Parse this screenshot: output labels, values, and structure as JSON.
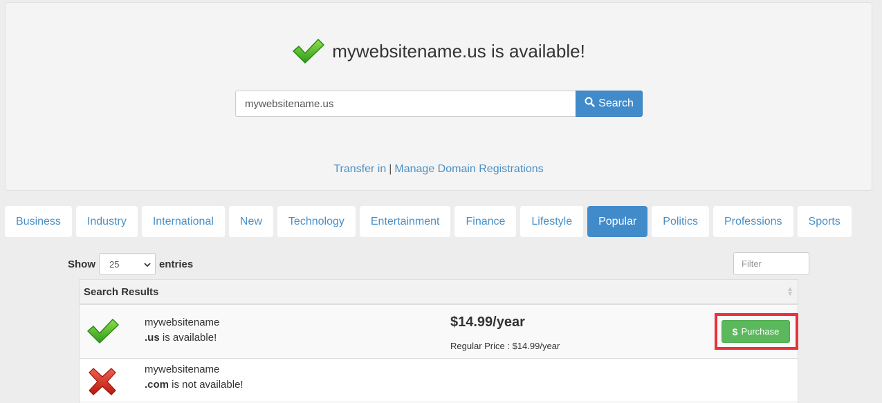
{
  "header": {
    "headline": "mywebsitename.us is available!"
  },
  "search": {
    "value": "mywebsitename.us",
    "button_label": "Search"
  },
  "links": {
    "transfer": "Transfer in",
    "separator": "|",
    "manage": "Manage Domain Registrations"
  },
  "tabs": [
    {
      "label": "Business",
      "active": false
    },
    {
      "label": "Industry",
      "active": false
    },
    {
      "label": "International",
      "active": false
    },
    {
      "label": "New",
      "active": false
    },
    {
      "label": "Technology",
      "active": false
    },
    {
      "label": "Entertainment",
      "active": false
    },
    {
      "label": "Finance",
      "active": false
    },
    {
      "label": "Lifestyle",
      "active": false
    },
    {
      "label": "Popular",
      "active": true
    },
    {
      "label": "Politics",
      "active": false
    },
    {
      "label": "Professions",
      "active": false
    },
    {
      "label": "Sports",
      "active": false
    }
  ],
  "table_controls": {
    "show_label": "Show",
    "entries_value": "25",
    "entries_label": "entries",
    "filter_placeholder": "Filter"
  },
  "results": {
    "header": "Search Results",
    "rows": [
      {
        "name": "mywebsitename",
        "tld": ".us",
        "status": " is available!",
        "price": "$14.99/year",
        "regular_price": "Regular Price : $14.99/year",
        "action": "Purchase"
      },
      {
        "name": "mywebsitename",
        "tld": ".com",
        "status": " is not available!"
      }
    ]
  },
  "colors": {
    "primary": "#428bca",
    "link": "#4a90c6",
    "success": "#5cb85c",
    "highlight": "#e8313a"
  }
}
